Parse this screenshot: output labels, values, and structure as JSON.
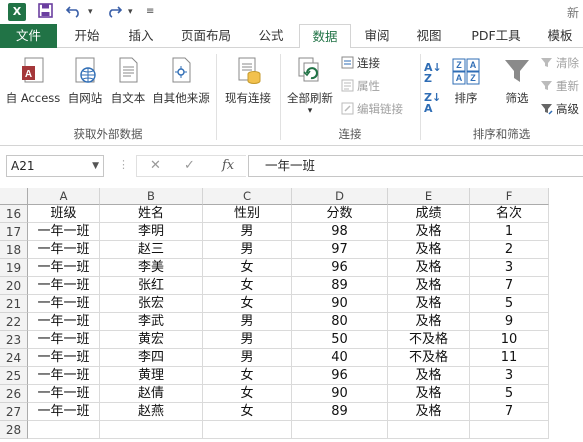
{
  "qat": {
    "title_fragment": "新"
  },
  "tabs": [
    {
      "label": "文件"
    },
    {
      "label": "开始"
    },
    {
      "label": "插入"
    },
    {
      "label": "页面布局"
    },
    {
      "label": "公式"
    },
    {
      "label": "数据"
    },
    {
      "label": "审阅"
    },
    {
      "label": "视图"
    },
    {
      "label": "PDF工具"
    },
    {
      "label": "模板"
    }
  ],
  "ribbon": {
    "get_external": {
      "access": "自 Access",
      "web": "自网站",
      "text": "自文本",
      "other": "自其他来源",
      "label": "获取外部数据"
    },
    "existing": "现有连接",
    "connections": {
      "refresh_all": "全部刷新",
      "connections": "连接",
      "properties": "属性",
      "edit_links": "编辑链接",
      "label": "连接"
    },
    "sort": {
      "sort": "排序",
      "filter": "筛选",
      "clear": "清除",
      "reapply": "重新",
      "advanced": "高级",
      "label": "排序和筛选"
    }
  },
  "formula_bar": {
    "name_box": "A21",
    "content": "一年一班"
  },
  "grid": {
    "columns": [
      "A",
      "B",
      "C",
      "D",
      "E",
      "F"
    ],
    "rows": [
      {
        "num": "16",
        "cells": [
          "班级",
          "姓名",
          "性别",
          "分数",
          "成绩",
          "名次"
        ]
      },
      {
        "num": "17",
        "cells": [
          "一年一班",
          "李明",
          "男",
          "98",
          "及格",
          "1"
        ]
      },
      {
        "num": "18",
        "cells": [
          "一年一班",
          "赵三",
          "男",
          "97",
          "及格",
          "2"
        ]
      },
      {
        "num": "19",
        "cells": [
          "一年一班",
          "李美",
          "女",
          "96",
          "及格",
          "3"
        ]
      },
      {
        "num": "20",
        "cells": [
          "一年一班",
          "张红",
          "女",
          "89",
          "及格",
          "7"
        ]
      },
      {
        "num": "21",
        "cells": [
          "一年一班",
          "张宏",
          "女",
          "90",
          "及格",
          "5"
        ]
      },
      {
        "num": "22",
        "cells": [
          "一年一班",
          "李武",
          "男",
          "80",
          "及格",
          "9"
        ]
      },
      {
        "num": "23",
        "cells": [
          "一年一班",
          "黄宏",
          "男",
          "50",
          "不及格",
          "10"
        ]
      },
      {
        "num": "24",
        "cells": [
          "一年一班",
          "李四",
          "男",
          "40",
          "不及格",
          "11"
        ]
      },
      {
        "num": "25",
        "cells": [
          "一年一班",
          "黄理",
          "女",
          "96",
          "及格",
          "3"
        ]
      },
      {
        "num": "26",
        "cells": [
          "一年一班",
          "赵倩",
          "女",
          "90",
          "及格",
          "5"
        ]
      },
      {
        "num": "27",
        "cells": [
          "一年一班",
          "赵燕",
          "女",
          "89",
          "及格",
          "7"
        ]
      },
      {
        "num": "28",
        "cells": [
          "",
          "",
          "",
          "",
          "",
          ""
        ]
      }
    ]
  },
  "colors": {
    "excel_green": "#217346"
  }
}
